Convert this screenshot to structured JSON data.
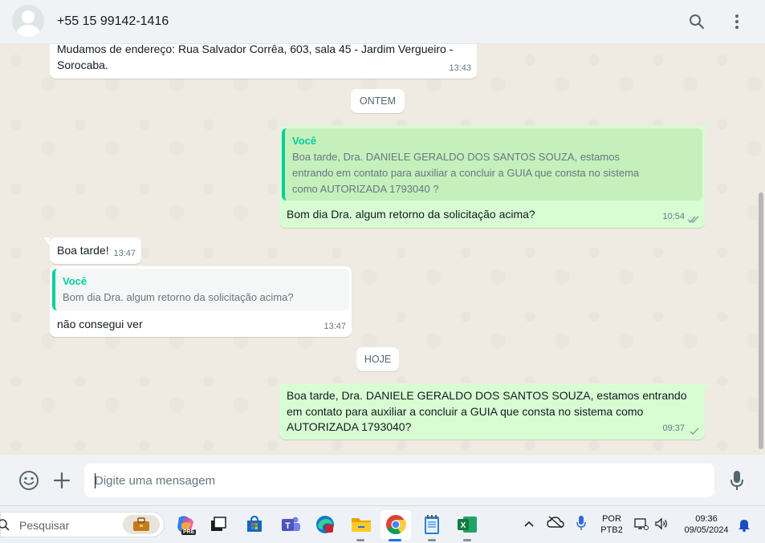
{
  "header": {
    "contact_name": "+55 15 99142-1416"
  },
  "messages": {
    "m1": {
      "text": "Mudamos de endereço: Rua Salvador Corrêa, 603, sala 45 - Jardim Vergueiro - Sorocaba.",
      "time": "13:43"
    },
    "day1": "ONTEM",
    "m2": {
      "quote_author": "Você",
      "quote_text": "Boa tarde, Dra. DANIELE GERALDO DOS SANTOS SOUZA, estamos entrando em contato para auxiliar a concluir a GUIA que consta no sistema como AUTORIZADA 1793040  ?",
      "text": "Bom dia Dra. algum retorno da solicitação acima?",
      "time": "10:54"
    },
    "m3": {
      "text": "Boa tarde!",
      "time": "13:47"
    },
    "m4": {
      "quote_author": "Você",
      "quote_text": "Bom dia Dra. algum retorno da solicitação acima?",
      "text": "não consegui ver",
      "time": "13:47"
    },
    "day2": "HOJE",
    "m5": {
      "text": "Boa tarde, Dra. DANIELE GERALDO DOS SANTOS SOUZA, estamos entrando em contato para auxiliar a concluir a GUIA que consta no sistema como AUTORIZADA 1793040?",
      "time": "09:37"
    }
  },
  "composer": {
    "placeholder": "Digite uma mensagem"
  },
  "taskbar": {
    "search_label": "Pesquisar",
    "copilot_badge": "PRE",
    "lang_top": "POR",
    "lang_bottom": "PTB2",
    "time": "09:36",
    "date": "09/05/2024"
  },
  "colors": {
    "accent": "#06cf9c",
    "outgoing_bubble": "#d9fdd3",
    "incoming_bubble": "#ffffff",
    "chat_bg": "#efeae2",
    "read_ticks": "#53bdeb",
    "sent_ticks": "#667781"
  }
}
